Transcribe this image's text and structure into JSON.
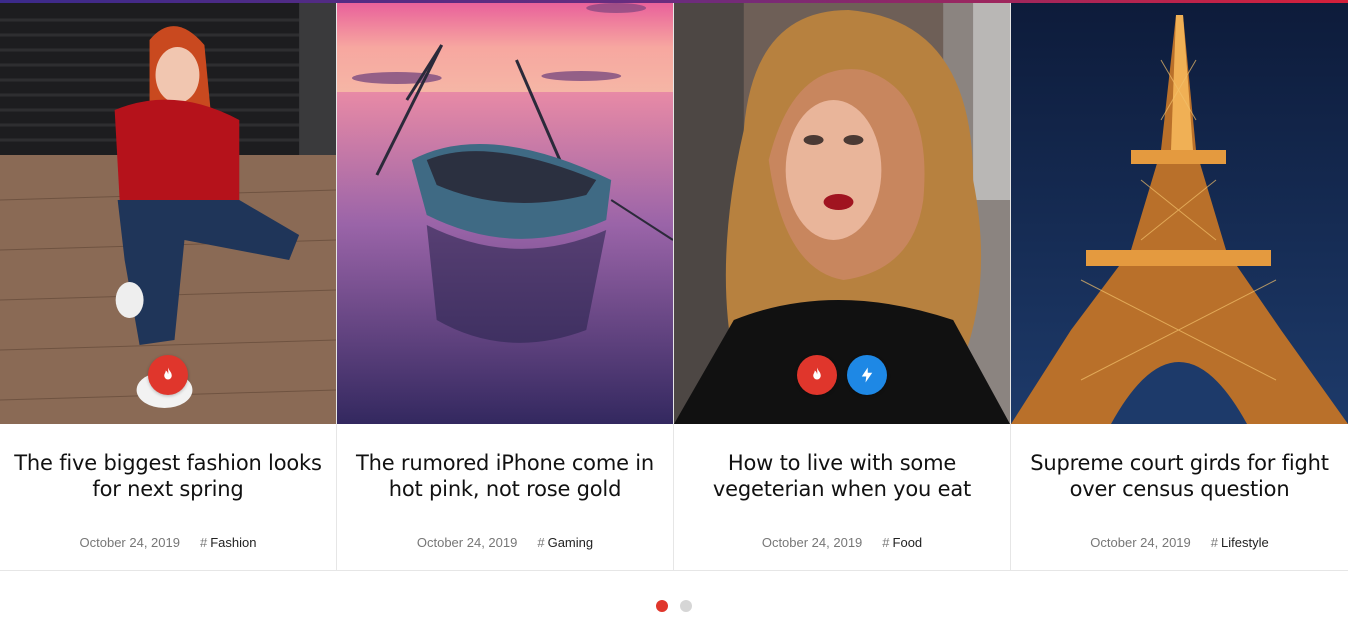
{
  "posts": [
    {
      "title": "The five biggest fashion looks for next spring",
      "date": "October 24, 2019",
      "category": "Fashion",
      "badges": [
        "hot"
      ]
    },
    {
      "title": "The rumored iPhone come in hot pink, not rose gold",
      "date": "October 24, 2019",
      "category": "Gaming",
      "badges": []
    },
    {
      "title": "How to live with some vegeterian when you eat",
      "date": "October 24, 2019",
      "category": "Food",
      "badges": [
        "hot",
        "trending"
      ]
    },
    {
      "title": "Supreme court girds for fight over census question",
      "date": "October 24, 2019",
      "category": "Lifestyle",
      "badges": []
    }
  ],
  "pagination": {
    "pages": 2,
    "active": 1
  },
  "colors": {
    "hot_badge": "#e0362c",
    "trending_badge": "#1e88e5",
    "active_dot": "#e0362c",
    "inactive_dot": "#d6d6d6"
  }
}
